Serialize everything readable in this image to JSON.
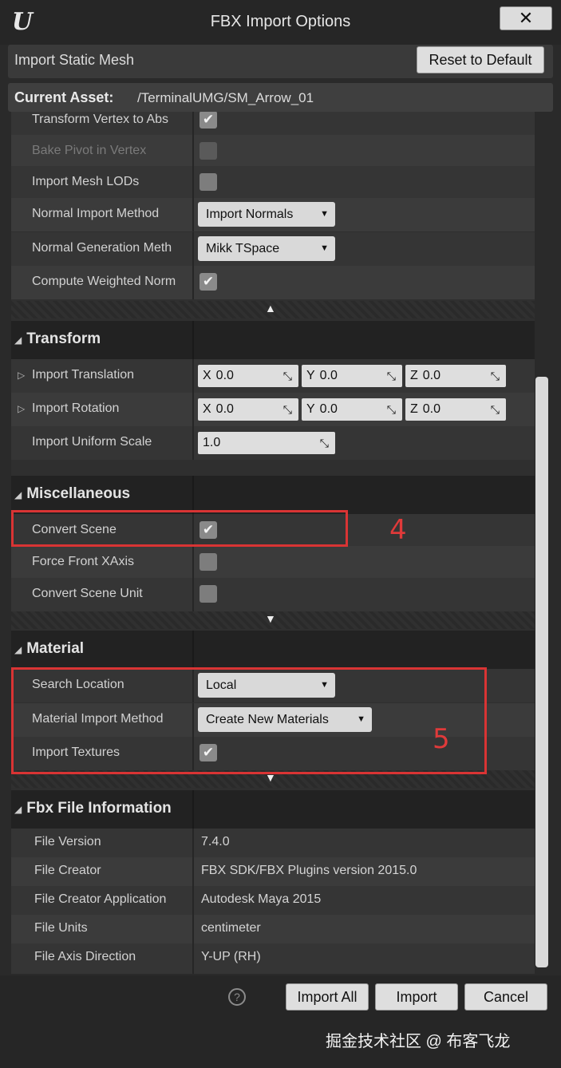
{
  "window": {
    "title": "FBX Import Options",
    "close_label": "✕"
  },
  "header": {
    "import_mode": "Import Static Mesh",
    "reset_label": "Reset to Default"
  },
  "asset": {
    "label": "Current Asset:",
    "path": "/TerminalUMG/SM_Arrow_01"
  },
  "mesh_rows": [
    {
      "label": "Transform Vertex to Abs",
      "checked": true
    },
    {
      "label": "Bake Pivot in Vertex",
      "checked": false,
      "disabled": true
    },
    {
      "label": "Import Mesh LODs",
      "checked": false
    },
    {
      "label": "Normal Import Method",
      "value": "Import Normals"
    },
    {
      "label": "Normal Generation Meth",
      "value": "Mikk TSpace"
    },
    {
      "label": "Compute Weighted Norm",
      "checked": true
    }
  ],
  "transform": {
    "title": "Transform",
    "translation_label": "Import Translation",
    "rotation_label": "Import Rotation",
    "scale_label": "Import Uniform Scale",
    "x_axis": "X",
    "y_axis": "Y",
    "z_axis": "Z",
    "translation": [
      "0.0",
      "0.0",
      "0.0"
    ],
    "rotation": [
      "0.0",
      "0.0",
      "0.0"
    ],
    "scale": "1.0"
  },
  "misc": {
    "title": "Miscellaneous",
    "convert_scene": "Convert Scene",
    "convert_scene_checked": true,
    "force_front": "Force Front XAxis",
    "force_front_checked": false,
    "convert_unit": "Convert Scene Unit",
    "convert_unit_checked": false
  },
  "material": {
    "title": "Material",
    "search_location_label": "Search Location",
    "search_location_value": "Local",
    "import_method_label": "Material Import Method",
    "import_method_value": "Create New Materials",
    "import_textures_label": "Import Textures",
    "import_textures_checked": true
  },
  "fbx_info": {
    "title": "Fbx File Information",
    "rows": [
      {
        "label": "File Version",
        "value": "7.4.0"
      },
      {
        "label": "File Creator",
        "value": "FBX SDK/FBX Plugins version 2015.0"
      },
      {
        "label": "File Creator Application",
        "value": "Autodesk Maya 2015"
      },
      {
        "label": "File Units",
        "value": "centimeter"
      },
      {
        "label": "File Axis Direction",
        "value": "Y-UP (RH)"
      }
    ]
  },
  "annotations": {
    "box4_label": "4",
    "box5_label": "5",
    "color": "#d93434"
  },
  "footer": {
    "help": "?",
    "import_all": "Import All",
    "import": "Import",
    "cancel": "Cancel",
    "watermark": "掘金技术社区 @ 布客飞龙"
  },
  "icons": {
    "checkmark": "✔",
    "dropdown": "▼",
    "collapse_up": "▲",
    "expand_down": "▼",
    "drag": "⤡",
    "section_open": "◢",
    "row_expand": "▷"
  }
}
